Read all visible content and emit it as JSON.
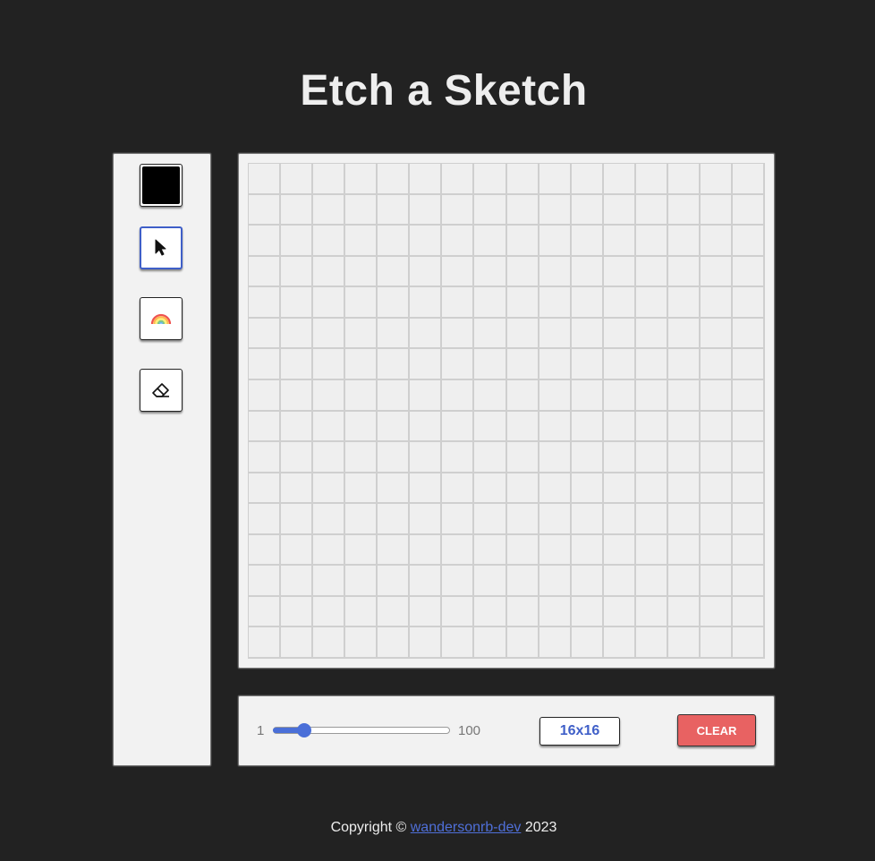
{
  "page": {
    "title": "Etch a Sketch"
  },
  "tools": {
    "current_color": "#000000",
    "items": [
      {
        "name": "color-picker",
        "icon": "color-swatch"
      },
      {
        "name": "pointer",
        "icon": "cursor-arrow-icon",
        "active": true
      },
      {
        "name": "rainbow",
        "icon": "rainbow-icon"
      },
      {
        "name": "eraser",
        "icon": "eraser-icon"
      }
    ]
  },
  "board": {
    "rows": 16,
    "cols": 16,
    "cell_color": "#efefef",
    "grid_line_color": "#cfcfcf"
  },
  "controls": {
    "range_min": "1",
    "range_max": "100",
    "slider_value": 16,
    "size_label": "16x16",
    "clear_label": "CLEAR",
    "accent_color": "#4a6fd8",
    "clear_color": "#e86262"
  },
  "footer": {
    "prefix": "Copyright ©",
    "link_text": "wandersonrb-dev",
    "suffix": "2023"
  }
}
